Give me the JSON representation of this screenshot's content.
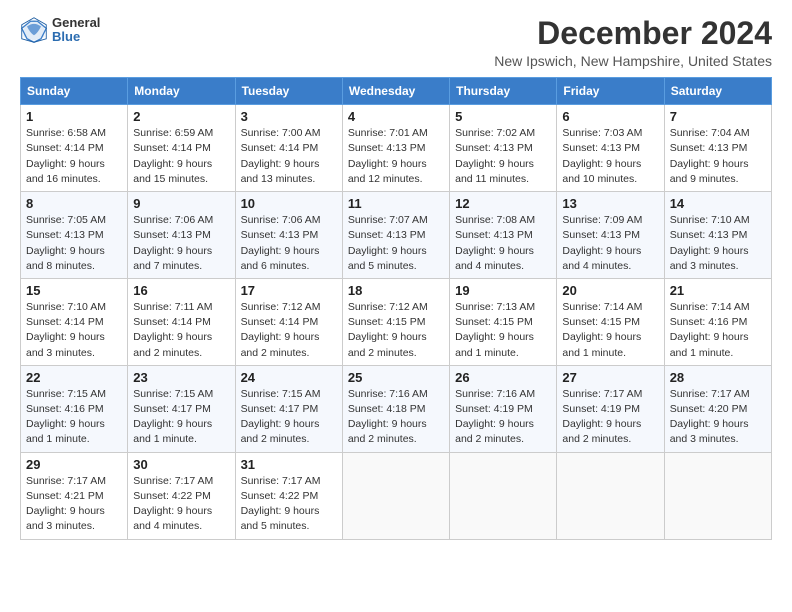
{
  "header": {
    "logo_general": "General",
    "logo_blue": "Blue",
    "month_title": "December 2024",
    "location": "New Ipswich, New Hampshire, United States"
  },
  "weekdays": [
    "Sunday",
    "Monday",
    "Tuesday",
    "Wednesday",
    "Thursday",
    "Friday",
    "Saturday"
  ],
  "weeks": [
    [
      {
        "day": "1",
        "sunrise": "Sunrise: 6:58 AM",
        "sunset": "Sunset: 4:14 PM",
        "daylight": "Daylight: 9 hours and 16 minutes."
      },
      {
        "day": "2",
        "sunrise": "Sunrise: 6:59 AM",
        "sunset": "Sunset: 4:14 PM",
        "daylight": "Daylight: 9 hours and 15 minutes."
      },
      {
        "day": "3",
        "sunrise": "Sunrise: 7:00 AM",
        "sunset": "Sunset: 4:14 PM",
        "daylight": "Daylight: 9 hours and 13 minutes."
      },
      {
        "day": "4",
        "sunrise": "Sunrise: 7:01 AM",
        "sunset": "Sunset: 4:13 PM",
        "daylight": "Daylight: 9 hours and 12 minutes."
      },
      {
        "day": "5",
        "sunrise": "Sunrise: 7:02 AM",
        "sunset": "Sunset: 4:13 PM",
        "daylight": "Daylight: 9 hours and 11 minutes."
      },
      {
        "day": "6",
        "sunrise": "Sunrise: 7:03 AM",
        "sunset": "Sunset: 4:13 PM",
        "daylight": "Daylight: 9 hours and 10 minutes."
      },
      {
        "day": "7",
        "sunrise": "Sunrise: 7:04 AM",
        "sunset": "Sunset: 4:13 PM",
        "daylight": "Daylight: 9 hours and 9 minutes."
      }
    ],
    [
      {
        "day": "8",
        "sunrise": "Sunrise: 7:05 AM",
        "sunset": "Sunset: 4:13 PM",
        "daylight": "Daylight: 9 hours and 8 minutes."
      },
      {
        "day": "9",
        "sunrise": "Sunrise: 7:06 AM",
        "sunset": "Sunset: 4:13 PM",
        "daylight": "Daylight: 9 hours and 7 minutes."
      },
      {
        "day": "10",
        "sunrise": "Sunrise: 7:06 AM",
        "sunset": "Sunset: 4:13 PM",
        "daylight": "Daylight: 9 hours and 6 minutes."
      },
      {
        "day": "11",
        "sunrise": "Sunrise: 7:07 AM",
        "sunset": "Sunset: 4:13 PM",
        "daylight": "Daylight: 9 hours and 5 minutes."
      },
      {
        "day": "12",
        "sunrise": "Sunrise: 7:08 AM",
        "sunset": "Sunset: 4:13 PM",
        "daylight": "Daylight: 9 hours and 4 minutes."
      },
      {
        "day": "13",
        "sunrise": "Sunrise: 7:09 AM",
        "sunset": "Sunset: 4:13 PM",
        "daylight": "Daylight: 9 hours and 4 minutes."
      },
      {
        "day": "14",
        "sunrise": "Sunrise: 7:10 AM",
        "sunset": "Sunset: 4:13 PM",
        "daylight": "Daylight: 9 hours and 3 minutes."
      }
    ],
    [
      {
        "day": "15",
        "sunrise": "Sunrise: 7:10 AM",
        "sunset": "Sunset: 4:14 PM",
        "daylight": "Daylight: 9 hours and 3 minutes."
      },
      {
        "day": "16",
        "sunrise": "Sunrise: 7:11 AM",
        "sunset": "Sunset: 4:14 PM",
        "daylight": "Daylight: 9 hours and 2 minutes."
      },
      {
        "day": "17",
        "sunrise": "Sunrise: 7:12 AM",
        "sunset": "Sunset: 4:14 PM",
        "daylight": "Daylight: 9 hours and 2 minutes."
      },
      {
        "day": "18",
        "sunrise": "Sunrise: 7:12 AM",
        "sunset": "Sunset: 4:15 PM",
        "daylight": "Daylight: 9 hours and 2 minutes."
      },
      {
        "day": "19",
        "sunrise": "Sunrise: 7:13 AM",
        "sunset": "Sunset: 4:15 PM",
        "daylight": "Daylight: 9 hours and 1 minute."
      },
      {
        "day": "20",
        "sunrise": "Sunrise: 7:14 AM",
        "sunset": "Sunset: 4:15 PM",
        "daylight": "Daylight: 9 hours and 1 minute."
      },
      {
        "day": "21",
        "sunrise": "Sunrise: 7:14 AM",
        "sunset": "Sunset: 4:16 PM",
        "daylight": "Daylight: 9 hours and 1 minute."
      }
    ],
    [
      {
        "day": "22",
        "sunrise": "Sunrise: 7:15 AM",
        "sunset": "Sunset: 4:16 PM",
        "daylight": "Daylight: 9 hours and 1 minute."
      },
      {
        "day": "23",
        "sunrise": "Sunrise: 7:15 AM",
        "sunset": "Sunset: 4:17 PM",
        "daylight": "Daylight: 9 hours and 1 minute."
      },
      {
        "day": "24",
        "sunrise": "Sunrise: 7:15 AM",
        "sunset": "Sunset: 4:17 PM",
        "daylight": "Daylight: 9 hours and 2 minutes."
      },
      {
        "day": "25",
        "sunrise": "Sunrise: 7:16 AM",
        "sunset": "Sunset: 4:18 PM",
        "daylight": "Daylight: 9 hours and 2 minutes."
      },
      {
        "day": "26",
        "sunrise": "Sunrise: 7:16 AM",
        "sunset": "Sunset: 4:19 PM",
        "daylight": "Daylight: 9 hours and 2 minutes."
      },
      {
        "day": "27",
        "sunrise": "Sunrise: 7:17 AM",
        "sunset": "Sunset: 4:19 PM",
        "daylight": "Daylight: 9 hours and 2 minutes."
      },
      {
        "day": "28",
        "sunrise": "Sunrise: 7:17 AM",
        "sunset": "Sunset: 4:20 PM",
        "daylight": "Daylight: 9 hours and 3 minutes."
      }
    ],
    [
      {
        "day": "29",
        "sunrise": "Sunrise: 7:17 AM",
        "sunset": "Sunset: 4:21 PM",
        "daylight": "Daylight: 9 hours and 3 minutes."
      },
      {
        "day": "30",
        "sunrise": "Sunrise: 7:17 AM",
        "sunset": "Sunset: 4:22 PM",
        "daylight": "Daylight: 9 hours and 4 minutes."
      },
      {
        "day": "31",
        "sunrise": "Sunrise: 7:17 AM",
        "sunset": "Sunset: 4:22 PM",
        "daylight": "Daylight: 9 hours and 5 minutes."
      },
      null,
      null,
      null,
      null
    ]
  ]
}
